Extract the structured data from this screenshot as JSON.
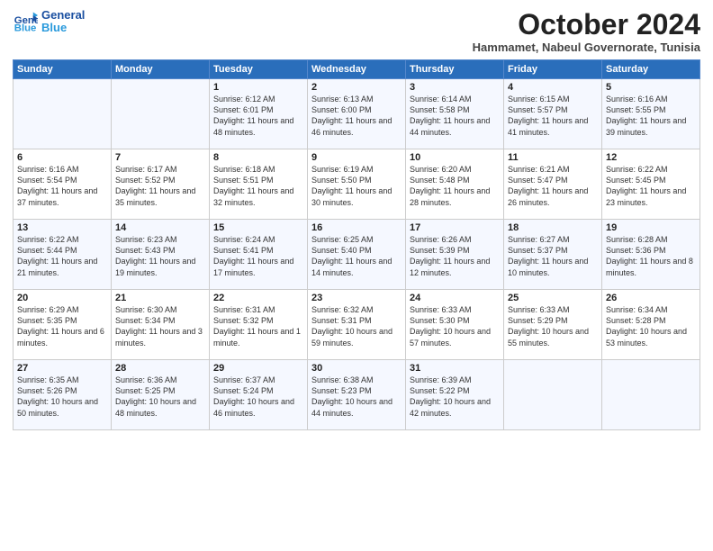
{
  "logo": {
    "line1": "General",
    "line2": "Blue"
  },
  "title": {
    "month": "October 2024",
    "location": "Hammamet, Nabeul Governorate, Tunisia"
  },
  "weekdays": [
    "Sunday",
    "Monday",
    "Tuesday",
    "Wednesday",
    "Thursday",
    "Friday",
    "Saturday"
  ],
  "weeks": [
    [
      {
        "day": "",
        "detail": ""
      },
      {
        "day": "",
        "detail": ""
      },
      {
        "day": "1",
        "detail": "Sunrise: 6:12 AM\nSunset: 6:01 PM\nDaylight: 11 hours and 48 minutes."
      },
      {
        "day": "2",
        "detail": "Sunrise: 6:13 AM\nSunset: 6:00 PM\nDaylight: 11 hours and 46 minutes."
      },
      {
        "day": "3",
        "detail": "Sunrise: 6:14 AM\nSunset: 5:58 PM\nDaylight: 11 hours and 44 minutes."
      },
      {
        "day": "4",
        "detail": "Sunrise: 6:15 AM\nSunset: 5:57 PM\nDaylight: 11 hours and 41 minutes."
      },
      {
        "day": "5",
        "detail": "Sunrise: 6:16 AM\nSunset: 5:55 PM\nDaylight: 11 hours and 39 minutes."
      }
    ],
    [
      {
        "day": "6",
        "detail": "Sunrise: 6:16 AM\nSunset: 5:54 PM\nDaylight: 11 hours and 37 minutes."
      },
      {
        "day": "7",
        "detail": "Sunrise: 6:17 AM\nSunset: 5:52 PM\nDaylight: 11 hours and 35 minutes."
      },
      {
        "day": "8",
        "detail": "Sunrise: 6:18 AM\nSunset: 5:51 PM\nDaylight: 11 hours and 32 minutes."
      },
      {
        "day": "9",
        "detail": "Sunrise: 6:19 AM\nSunset: 5:50 PM\nDaylight: 11 hours and 30 minutes."
      },
      {
        "day": "10",
        "detail": "Sunrise: 6:20 AM\nSunset: 5:48 PM\nDaylight: 11 hours and 28 minutes."
      },
      {
        "day": "11",
        "detail": "Sunrise: 6:21 AM\nSunset: 5:47 PM\nDaylight: 11 hours and 26 minutes."
      },
      {
        "day": "12",
        "detail": "Sunrise: 6:22 AM\nSunset: 5:45 PM\nDaylight: 11 hours and 23 minutes."
      }
    ],
    [
      {
        "day": "13",
        "detail": "Sunrise: 6:22 AM\nSunset: 5:44 PM\nDaylight: 11 hours and 21 minutes."
      },
      {
        "day": "14",
        "detail": "Sunrise: 6:23 AM\nSunset: 5:43 PM\nDaylight: 11 hours and 19 minutes."
      },
      {
        "day": "15",
        "detail": "Sunrise: 6:24 AM\nSunset: 5:41 PM\nDaylight: 11 hours and 17 minutes."
      },
      {
        "day": "16",
        "detail": "Sunrise: 6:25 AM\nSunset: 5:40 PM\nDaylight: 11 hours and 14 minutes."
      },
      {
        "day": "17",
        "detail": "Sunrise: 6:26 AM\nSunset: 5:39 PM\nDaylight: 11 hours and 12 minutes."
      },
      {
        "day": "18",
        "detail": "Sunrise: 6:27 AM\nSunset: 5:37 PM\nDaylight: 11 hours and 10 minutes."
      },
      {
        "day": "19",
        "detail": "Sunrise: 6:28 AM\nSunset: 5:36 PM\nDaylight: 11 hours and 8 minutes."
      }
    ],
    [
      {
        "day": "20",
        "detail": "Sunrise: 6:29 AM\nSunset: 5:35 PM\nDaylight: 11 hours and 6 minutes."
      },
      {
        "day": "21",
        "detail": "Sunrise: 6:30 AM\nSunset: 5:34 PM\nDaylight: 11 hours and 3 minutes."
      },
      {
        "day": "22",
        "detail": "Sunrise: 6:31 AM\nSunset: 5:32 PM\nDaylight: 11 hours and 1 minute."
      },
      {
        "day": "23",
        "detail": "Sunrise: 6:32 AM\nSunset: 5:31 PM\nDaylight: 10 hours and 59 minutes."
      },
      {
        "day": "24",
        "detail": "Sunrise: 6:33 AM\nSunset: 5:30 PM\nDaylight: 10 hours and 57 minutes."
      },
      {
        "day": "25",
        "detail": "Sunrise: 6:33 AM\nSunset: 5:29 PM\nDaylight: 10 hours and 55 minutes."
      },
      {
        "day": "26",
        "detail": "Sunrise: 6:34 AM\nSunset: 5:28 PM\nDaylight: 10 hours and 53 minutes."
      }
    ],
    [
      {
        "day": "27",
        "detail": "Sunrise: 6:35 AM\nSunset: 5:26 PM\nDaylight: 10 hours and 50 minutes."
      },
      {
        "day": "28",
        "detail": "Sunrise: 6:36 AM\nSunset: 5:25 PM\nDaylight: 10 hours and 48 minutes."
      },
      {
        "day": "29",
        "detail": "Sunrise: 6:37 AM\nSunset: 5:24 PM\nDaylight: 10 hours and 46 minutes."
      },
      {
        "day": "30",
        "detail": "Sunrise: 6:38 AM\nSunset: 5:23 PM\nDaylight: 10 hours and 44 minutes."
      },
      {
        "day": "31",
        "detail": "Sunrise: 6:39 AM\nSunset: 5:22 PM\nDaylight: 10 hours and 42 minutes."
      },
      {
        "day": "",
        "detail": ""
      },
      {
        "day": "",
        "detail": ""
      }
    ]
  ]
}
